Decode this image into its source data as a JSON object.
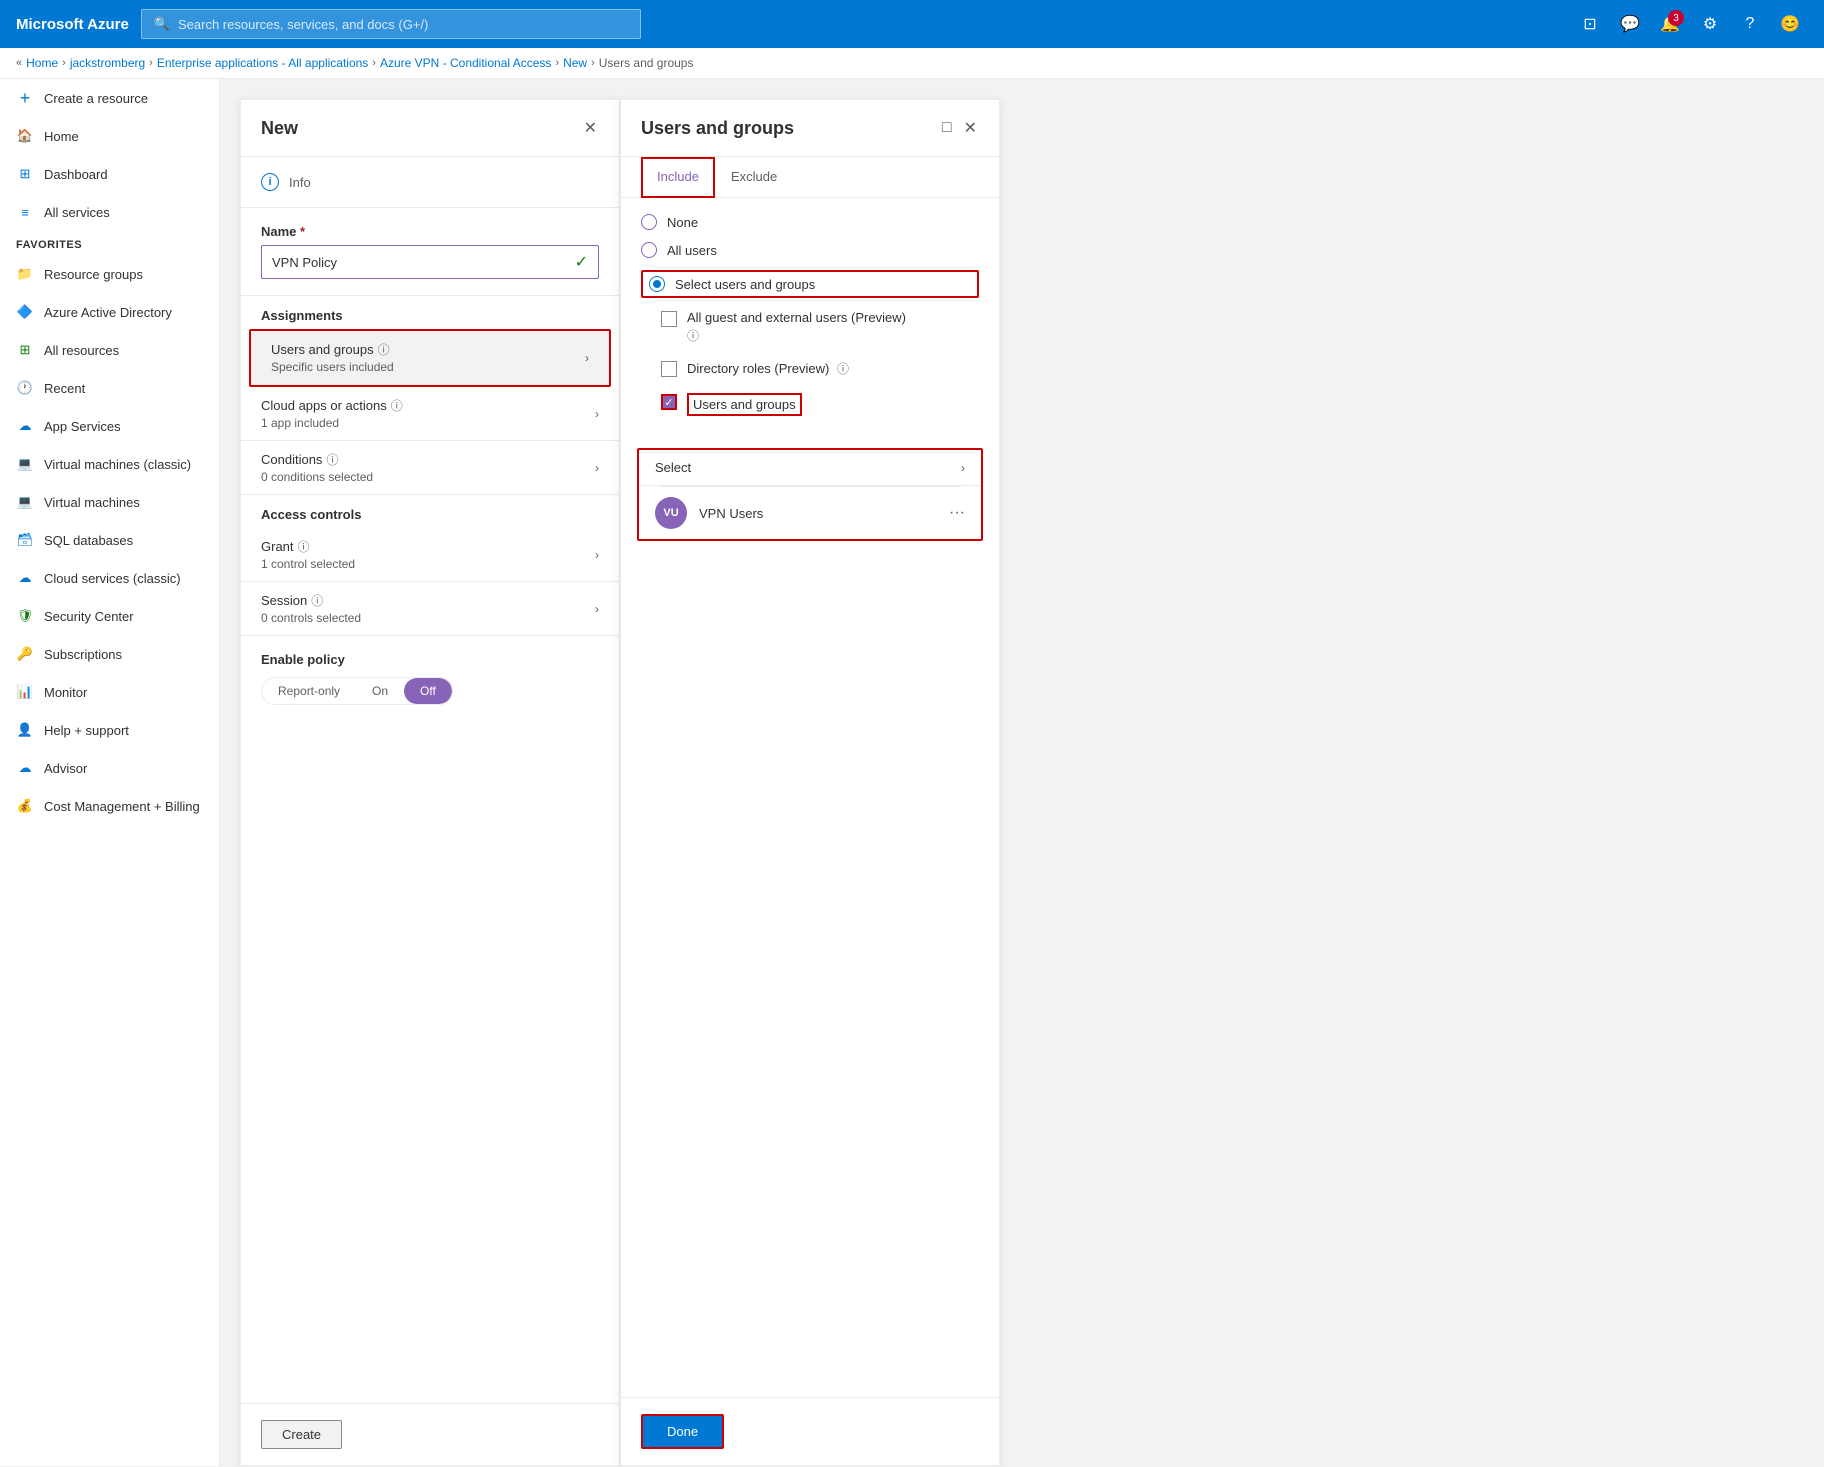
{
  "topbar": {
    "logo": "Microsoft Azure",
    "search_placeholder": "Search resources, services, and docs (G+/)",
    "notification_count": "3"
  },
  "breadcrumb": {
    "collapse": "«",
    "items": [
      "Home",
      "jackstromberg",
      "Enterprise applications - All applications",
      "Azure VPN - Conditional Access",
      "New",
      "Users and groups"
    ]
  },
  "sidebar": {
    "create_label": "Create a resource",
    "items": [
      {
        "id": "home",
        "label": "Home",
        "icon": "🏠"
      },
      {
        "id": "dashboard",
        "label": "Dashboard",
        "icon": "⊞"
      },
      {
        "id": "all-services",
        "label": "All services",
        "icon": "≡"
      }
    ],
    "favorites_label": "FAVORITES",
    "favorites": [
      {
        "id": "resource-groups",
        "label": "Resource groups",
        "icon": "📁"
      },
      {
        "id": "azure-active-directory",
        "label": "Azure Active Directory",
        "icon": "🔷"
      },
      {
        "id": "all-resources",
        "label": "All resources",
        "icon": "⊞"
      },
      {
        "id": "recent",
        "label": "Recent",
        "icon": "🕐"
      },
      {
        "id": "app-services",
        "label": "App Services",
        "icon": "☁"
      },
      {
        "id": "virtual-machines-classic",
        "label": "Virtual machines (classic)",
        "icon": "💻"
      },
      {
        "id": "virtual-machines",
        "label": "Virtual machines",
        "icon": "💻"
      },
      {
        "id": "sql-databases",
        "label": "SQL databases",
        "icon": "🗃"
      },
      {
        "id": "cloud-services",
        "label": "Cloud services (classic)",
        "icon": "☁"
      },
      {
        "id": "security-center",
        "label": "Security Center",
        "icon": "🛡"
      },
      {
        "id": "subscriptions",
        "label": "Subscriptions",
        "icon": "🔑"
      },
      {
        "id": "monitor",
        "label": "Monitor",
        "icon": "📊"
      },
      {
        "id": "help-support",
        "label": "Help + support",
        "icon": "👤"
      },
      {
        "id": "advisor",
        "label": "Advisor",
        "icon": "☁"
      },
      {
        "id": "cost-management",
        "label": "Cost Management + Billing",
        "icon": "💰"
      }
    ]
  },
  "new_panel": {
    "title": "New",
    "info_label": "Info",
    "name_label": "Name",
    "name_required": "*",
    "name_value": "VPN Policy",
    "assignments_label": "Assignments",
    "users_groups_row": {
      "title": "Users and groups",
      "subtitle": "Specific users included"
    },
    "cloud_apps_row": {
      "title": "Cloud apps or actions",
      "subtitle": "1 app included"
    },
    "conditions_row": {
      "title": "Conditions",
      "subtitle": "0 conditions selected"
    },
    "access_controls_label": "Access controls",
    "grant_row": {
      "title": "Grant",
      "subtitle": "1 control selected"
    },
    "session_row": {
      "title": "Session",
      "subtitle": "0 controls selected"
    },
    "enable_policy_label": "Enable policy",
    "toggle_options": [
      "Report-only",
      "On",
      "Off"
    ],
    "active_toggle": "Off",
    "create_button": "Create"
  },
  "users_panel": {
    "title": "Users and groups",
    "tab_include": "Include",
    "tab_exclude": "Exclude",
    "radio_options": [
      {
        "id": "none",
        "label": "None",
        "selected": false
      },
      {
        "id": "all-users",
        "label": "All users",
        "selected": false
      },
      {
        "id": "select-users",
        "label": "Select users and groups",
        "selected": true
      }
    ],
    "checkbox_options": [
      {
        "id": "guest-external",
        "label": "All guest and external users (Preview)",
        "checked": false
      },
      {
        "id": "directory-roles",
        "label": "Directory roles (Preview)",
        "checked": false
      },
      {
        "id": "users-and-groups",
        "label": "Users and groups",
        "checked": true
      }
    ],
    "select_label": "Select",
    "users": [
      {
        "initials": "VU",
        "name": "VPN Users"
      }
    ],
    "done_button": "Done"
  }
}
